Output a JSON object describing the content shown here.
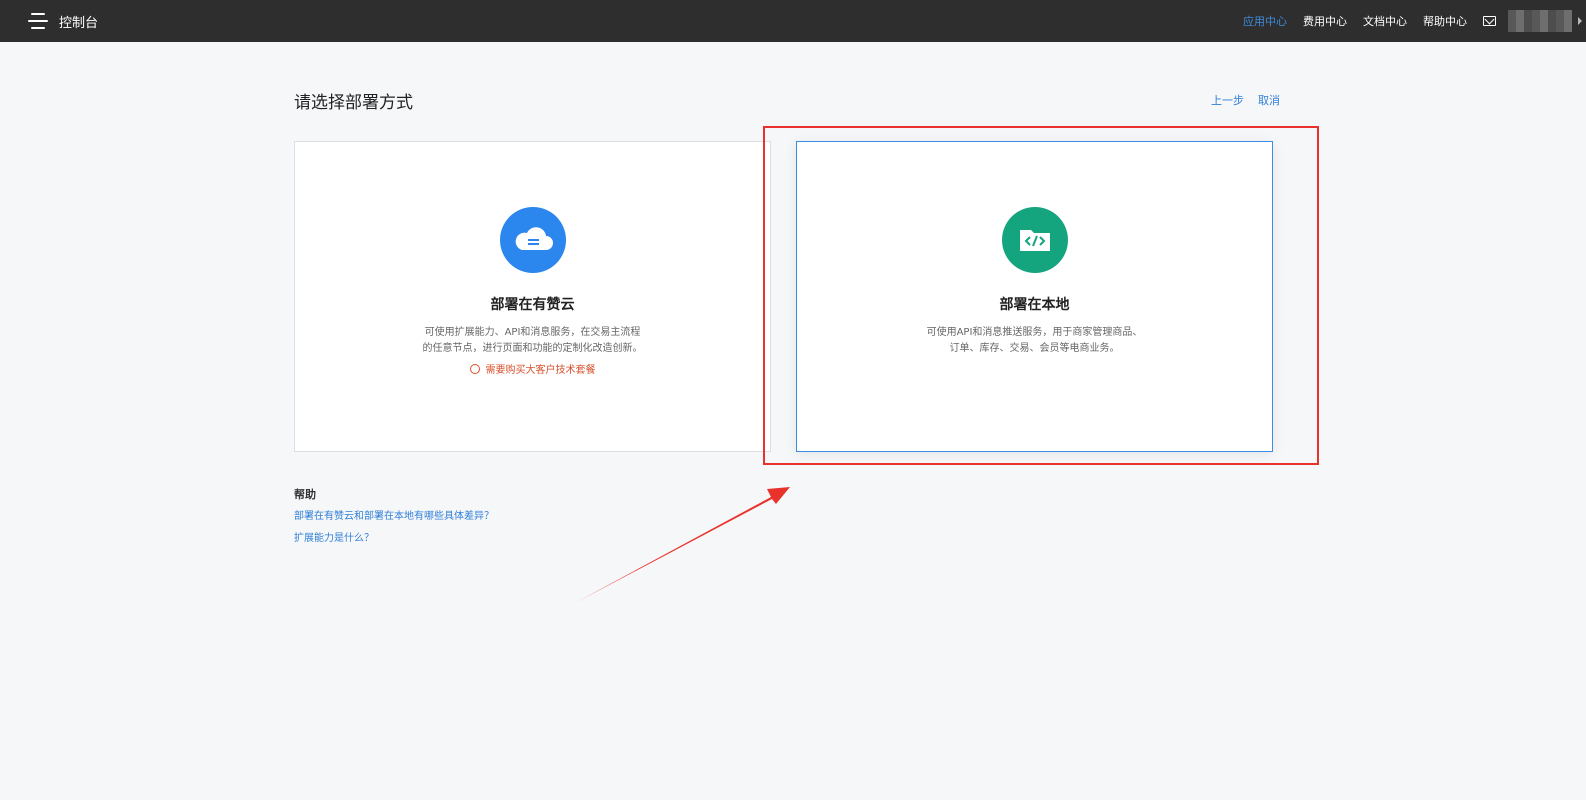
{
  "topbar": {
    "brand": "控制台",
    "links": [
      "应用中心",
      "费用中心",
      "文档中心",
      "帮助中心"
    ]
  },
  "page": {
    "title": "请选择部署方式",
    "prev_step": "上一步",
    "cancel": "取消"
  },
  "cards": {
    "cloud": {
      "icon": "cloud-icon",
      "title": "部署在有赞云",
      "desc_line1": "可使用扩展能力、API和消息服务，在交易主流程",
      "desc_line2": "的任意节点，进行页面和功能的定制化改造创新。",
      "warning": "需要购买大客户技术套餐"
    },
    "local": {
      "icon": "code-folder-icon",
      "title": "部署在本地",
      "desc_line1": "可使用API和消息推送服务，用于商家管理商品、",
      "desc_line2": "订单、库存、交易、会员等电商业务。"
    }
  },
  "help": {
    "title": "帮助",
    "links": [
      "部署在有赞云和部署在本地有哪些具体差异？",
      "扩展能力是什么？"
    ]
  },
  "colors": {
    "topbar": "#2e2e2e",
    "accent": "#2f7fd6",
    "cloud_icon": "#2b86ee",
    "local_icon": "#14a57e",
    "warning": "#d9502c",
    "annotation": "#e8322b"
  }
}
